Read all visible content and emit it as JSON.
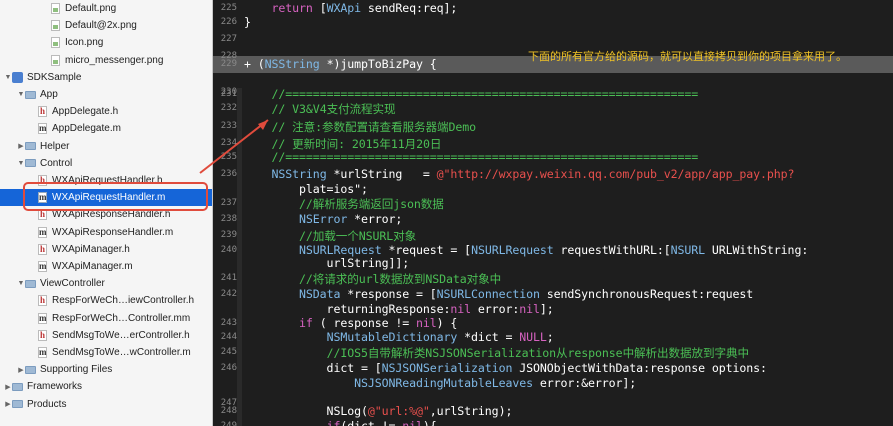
{
  "sidebar": {
    "items": [
      {
        "label": "Default.png",
        "type": "image"
      },
      {
        "label": "Default@2x.png",
        "type": "image"
      },
      {
        "label": "Icon.png",
        "type": "image"
      },
      {
        "label": "micro_messenger.png",
        "type": "image"
      },
      {
        "label": "SDKSample",
        "type": "project"
      },
      {
        "label": "App",
        "type": "folder"
      },
      {
        "label": "AppDelegate.h",
        "type": "h"
      },
      {
        "label": "AppDelegate.m",
        "type": "m"
      },
      {
        "label": "Helper",
        "type": "folder"
      },
      {
        "label": "Control",
        "type": "folder"
      },
      {
        "label": "WXApiRequestHandler.h",
        "type": "h"
      },
      {
        "label": "WXApiRequestHandler.m",
        "type": "m"
      },
      {
        "label": "WXApiResponseHandler.h",
        "type": "h"
      },
      {
        "label": "WXApiResponseHandler.m",
        "type": "m"
      },
      {
        "label": "WXApiManager.h",
        "type": "h"
      },
      {
        "label": "WXApiManager.m",
        "type": "m"
      },
      {
        "label": "ViewController",
        "type": "folder"
      },
      {
        "label": "RespForWeCh…iewController.h",
        "type": "h"
      },
      {
        "label": "RespForWeCh…Controller.mm",
        "type": "m"
      },
      {
        "label": "SendMsgToWe…erController.h",
        "type": "h"
      },
      {
        "label": "SendMsgToWe…wController.m",
        "type": "m"
      },
      {
        "label": "Supporting Files",
        "type": "folder"
      },
      {
        "label": "Frameworks",
        "type": "folder"
      },
      {
        "label": "Products",
        "type": "folder"
      }
    ]
  },
  "editor": {
    "annotation": "下面的所有官方给的源码，就可以直接拷贝到你的项目拿来用了。",
    "lines": [
      {
        "n": "225",
        "c": "    return [WXApi sendReq:req];"
      },
      {
        "n": "226",
        "c": "}"
      },
      {
        "n": "227",
        "c": ""
      },
      {
        "n": "228",
        "c": ""
      },
      {
        "n": "229",
        "c": "+ (NSString *)jumpToBizPay {"
      },
      {
        "n": "230",
        "c": ""
      },
      {
        "n": "231",
        "c": "    //============================================================"
      },
      {
        "n": "232",
        "c": "    // V3&V4支付流程实现"
      },
      {
        "n": "233",
        "c": "    // 注意:参数配置请查看服务器端Demo"
      },
      {
        "n": "234",
        "c": "    // 更新时间: 2015年11月20日"
      },
      {
        "n": "235",
        "c": "    //============================================================"
      },
      {
        "n": "236",
        "c": "    NSString *urlString   = @\"http://wxpay.weixin.qq.com/pub_v2/app/app_pay.php?"
      },
      {
        "n": "",
        "c": "        plat=ios\";"
      },
      {
        "n": "237",
        "c": "        //解析服务端返回json数据"
      },
      {
        "n": "238",
        "c": "        NSError *error;"
      },
      {
        "n": "239",
        "c": "        //加载一个NSURL对象"
      },
      {
        "n": "240",
        "c": "        NSURLRequest *request = [NSURLRequest requestWithURL:[NSURL URLWithString:"
      },
      {
        "n": "",
        "c": "            urlString]];"
      },
      {
        "n": "241",
        "c": "        //将请求的url数据放到NSData对象中"
      },
      {
        "n": "242",
        "c": "        NSData *response = [NSURLConnection sendSynchronousRequest:request"
      },
      {
        "n": "",
        "c": "            returningResponse:nil error:nil];"
      },
      {
        "n": "243",
        "c": "        if ( response != nil) {"
      },
      {
        "n": "244",
        "c": "            NSMutableDictionary *dict = NULL;"
      },
      {
        "n": "245",
        "c": "            //IOS5自带解析类NSJSONSerialization从response中解析出数据放到字典中"
      },
      {
        "n": "246",
        "c": "            dict = [NSJSONSerialization JSONObjectWithData:response options:"
      },
      {
        "n": "",
        "c": "                NSJSONReadingMutableLeaves error:&error];"
      },
      {
        "n": "247",
        "c": ""
      },
      {
        "n": "248",
        "c": "            NSLog(@\"url:%@\",urlString);"
      },
      {
        "n": "249",
        "c": "            if(dict != nil){"
      }
    ]
  },
  "colors": {
    "accent": "#1565d8",
    "annotation": "#f0c325",
    "highlight_box": "#e04b3c"
  }
}
